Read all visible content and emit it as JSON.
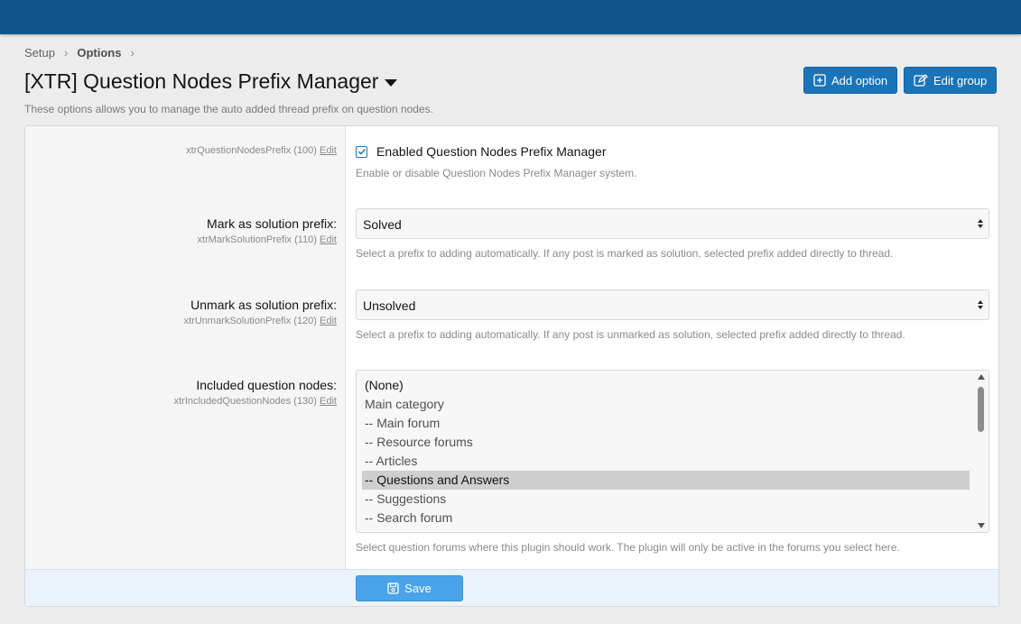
{
  "breadcrumb": {
    "items": [
      "Setup",
      "Options"
    ]
  },
  "page": {
    "title": "[XTR] Question Nodes Prefix Manager",
    "description": "These options allows you to manage the auto added thread prefix on question nodes."
  },
  "actions": {
    "add_option": "Add option",
    "edit_group": "Edit group"
  },
  "options": {
    "enabled": {
      "hint_id": "xtrQuestionNodesPrefix (100)",
      "edit": "Edit",
      "checkbox_label": "Enabled Question Nodes Prefix Manager",
      "checked": true,
      "explain": "Enable or disable Question Nodes Prefix Manager system."
    },
    "mark": {
      "label": "Mark as solution prefix:",
      "hint_id": "xtrMarkSolutionPrefix (110)",
      "edit": "Edit",
      "value": "Solved",
      "explain": "Select a prefix to adding automatically. If any post is marked as solution, selected prefix added directly to thread."
    },
    "unmark": {
      "label": "Unmark as solution prefix:",
      "hint_id": "xtrUnmarkSolutionPrefix (120)",
      "edit": "Edit",
      "value": "Unsolved",
      "explain": "Select a prefix to adding automatically. If any post is unmarked as solution, selected prefix added directly to thread."
    },
    "nodes": {
      "label": "Included question nodes:",
      "hint_id": "xtrIncludedQuestionNodes (130)",
      "edit": "Edit",
      "items": [
        "(None)",
        "Main category",
        "-- Main forum",
        "-- Resource forums",
        "-- Articles",
        "-- Questions and Answers",
        "-- Suggestions",
        "-- Search forum"
      ],
      "selected": "-- Questions and Answers",
      "explain": "Select question forums where this plugin should work. The plugin will only be active in the forums you select here."
    }
  },
  "footer": {
    "save": "Save"
  },
  "colors": {
    "topbar": "#0f578a",
    "button": "#1a74b8",
    "save": "#4aa3e8"
  }
}
